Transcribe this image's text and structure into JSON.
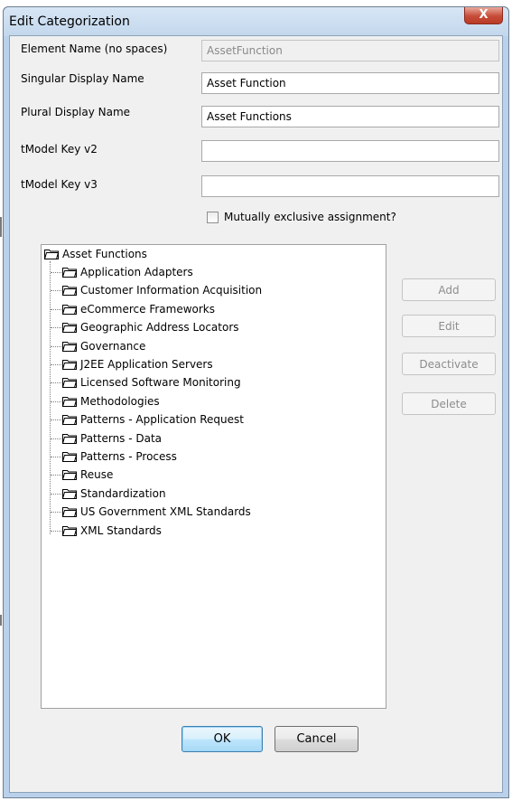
{
  "window": {
    "title": "Edit Categorization",
    "close_glyph": "X"
  },
  "form": {
    "element_name_label": "Element Name (no spaces)",
    "element_name_value": "AssetFunction",
    "singular_label": "Singular Display Name",
    "singular_value": "Asset Function",
    "plural_label": "Plural Display Name",
    "plural_value": "Asset Functions",
    "tmodel_v2_label": "tModel Key v2",
    "tmodel_v2_value": "",
    "tmodel_v3_label": "tModel Key v3",
    "tmodel_v3_value": "",
    "mutually_exclusive_label": "Mutually exclusive assignment?",
    "mutually_exclusive_checked": false
  },
  "tree": {
    "root": "Asset Functions",
    "items": [
      "Application Adapters",
      "Customer Information Acquisition",
      "eCommerce Frameworks",
      "Geographic Address Locators",
      "Governance",
      "J2EE Application Servers",
      "Licensed Software Monitoring",
      "Methodologies",
      "Patterns - Application Request",
      "Patterns - Data",
      "Patterns - Process",
      "Reuse",
      "Standardization",
      "US Government XML Standards",
      "XML Standards"
    ]
  },
  "side_buttons": {
    "add": "Add",
    "edit": "Edit",
    "deactivate": "Deactivate",
    "delete": "Delete"
  },
  "footer": {
    "ok": "OK",
    "cancel": "Cancel"
  },
  "icons": {
    "folder": "folder-icon",
    "close": "close-icon",
    "checkbox": "checkbox-icon"
  },
  "colors": {
    "title_bar": "#c3d7ec",
    "close_button": "#c74c38",
    "dialog_bg": "#f0f0f0",
    "disabled_text": "#8d8d8d"
  }
}
